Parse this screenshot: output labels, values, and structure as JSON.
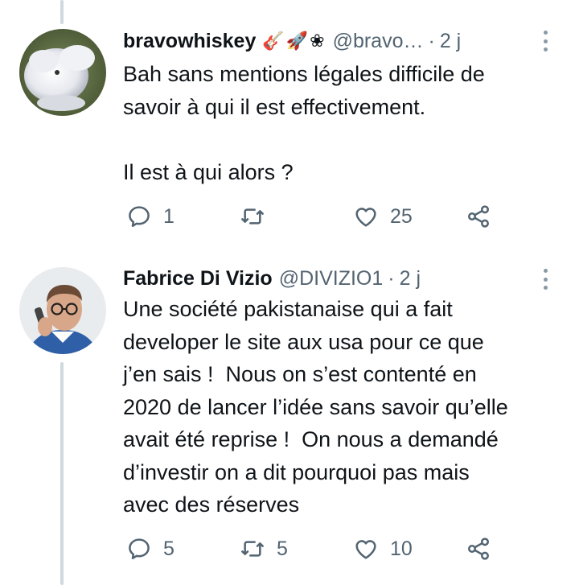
{
  "tweets": [
    {
      "name": "bravowhiskey",
      "emojis": "🎸🚀❀",
      "handle": "@bravo…",
      "time": "2 j",
      "text": "Bah sans mentions légales difficile de\nsavoir à qui il est effectivement.\n\nIl est à qui alors ?",
      "reply_count": "1",
      "retweet_count": "",
      "like_count": "25"
    },
    {
      "name": "Fabrice Di Vizio",
      "emojis": "",
      "handle": "@DIVIZIO1",
      "time": "2 j",
      "text": "Une société pakistanaise qui a fait\ndeveloper le site aux usa pour ce que\nj’en sais !  Nous on s’est contenté en\n2020 de lancer l’idée sans savoir qu’elle\navait été reprise !  On nous a demandé\nd’investir on a dit pourquoi pas mais\navec des réserves",
      "reply_count": "5",
      "retweet_count": "5",
      "like_count": "10"
    }
  ],
  "separator": "·",
  "colors": {
    "text": "#0f1419",
    "secondary": "#536471",
    "thread_line": "#cfd9de"
  },
  "icons": [
    "reply-icon",
    "retweet-icon",
    "like-icon",
    "share-icon",
    "more-icon"
  ]
}
